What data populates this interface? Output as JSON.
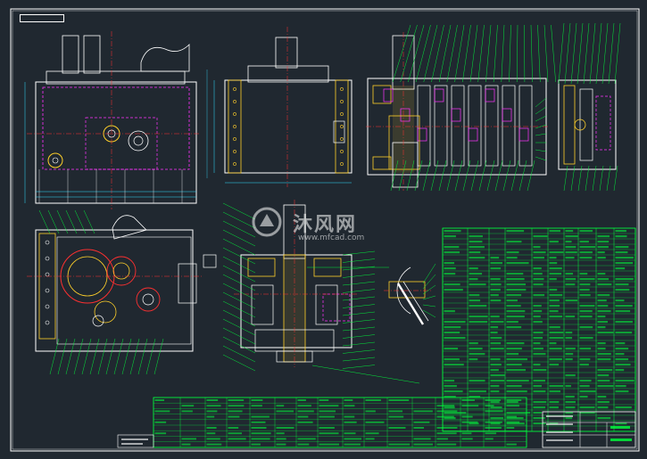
{
  "drawing": {
    "title_tag": "",
    "watermark_cn": "沐风网",
    "watermark_url": "www.mfcad.com"
  },
  "colors": {
    "background": "#202830",
    "frame": "#ffffff",
    "part_lines": "#ffffff",
    "leaders": "#00ff3c",
    "hidden_lines": "#ff33ff",
    "dimensions": "#33ddff",
    "center_lines": "#ff3030",
    "bearings": "#ffd02a",
    "watermark": "rgba(255,255,255,0.55)"
  },
  "views": [
    {
      "id": "front-view",
      "icon": "housing-front-view"
    },
    {
      "id": "side-view",
      "icon": "housing-side-view"
    },
    {
      "id": "section-a",
      "icon": "gear-train-section"
    },
    {
      "id": "section-b",
      "icon": "shift-mechanism-section"
    },
    {
      "id": "plan-view",
      "icon": "gear-layout-plan"
    },
    {
      "id": "center-section",
      "icon": "spindle-section"
    },
    {
      "id": "lever-detail",
      "icon": "lever-detail"
    }
  ],
  "tables": {
    "parts_list": {
      "icon": "parts-list-table"
    },
    "tech_requirements": {
      "icon": "technical-notes-table"
    },
    "title_block": {
      "icon": "title-block"
    }
  }
}
